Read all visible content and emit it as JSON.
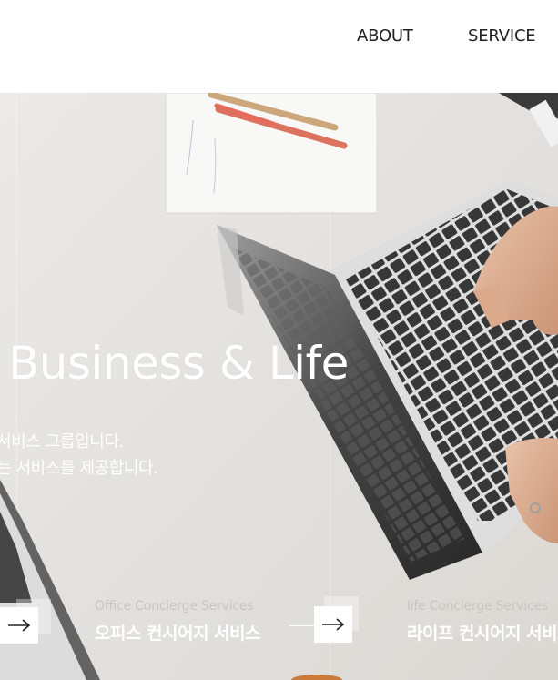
{
  "nav": {
    "items": [
      {
        "label": "ABOUT"
      },
      {
        "label": "SERVICE"
      }
    ]
  },
  "hero": {
    "title": "Business & Life",
    "desc_line1": "서비스 그룹입니다.",
    "desc_line2": "는 서비스를 제공합니다."
  },
  "services": [
    {
      "en": "Office Concierge Services",
      "ko": "오피스 컨시어지 서비스",
      "icon": "arrow-right-icon"
    },
    {
      "en": "life Concierge Services",
      "ko": "라이프 컨시어지 서비스",
      "icon": "arrow-right-icon"
    }
  ],
  "colors": {
    "text_dark": "#222222",
    "white": "#ffffff",
    "muted": "#c9c6c2",
    "laptop_silver": "#dcdcdc",
    "keyboard": "#2b2b2b",
    "desk": "#e9e7e4"
  }
}
